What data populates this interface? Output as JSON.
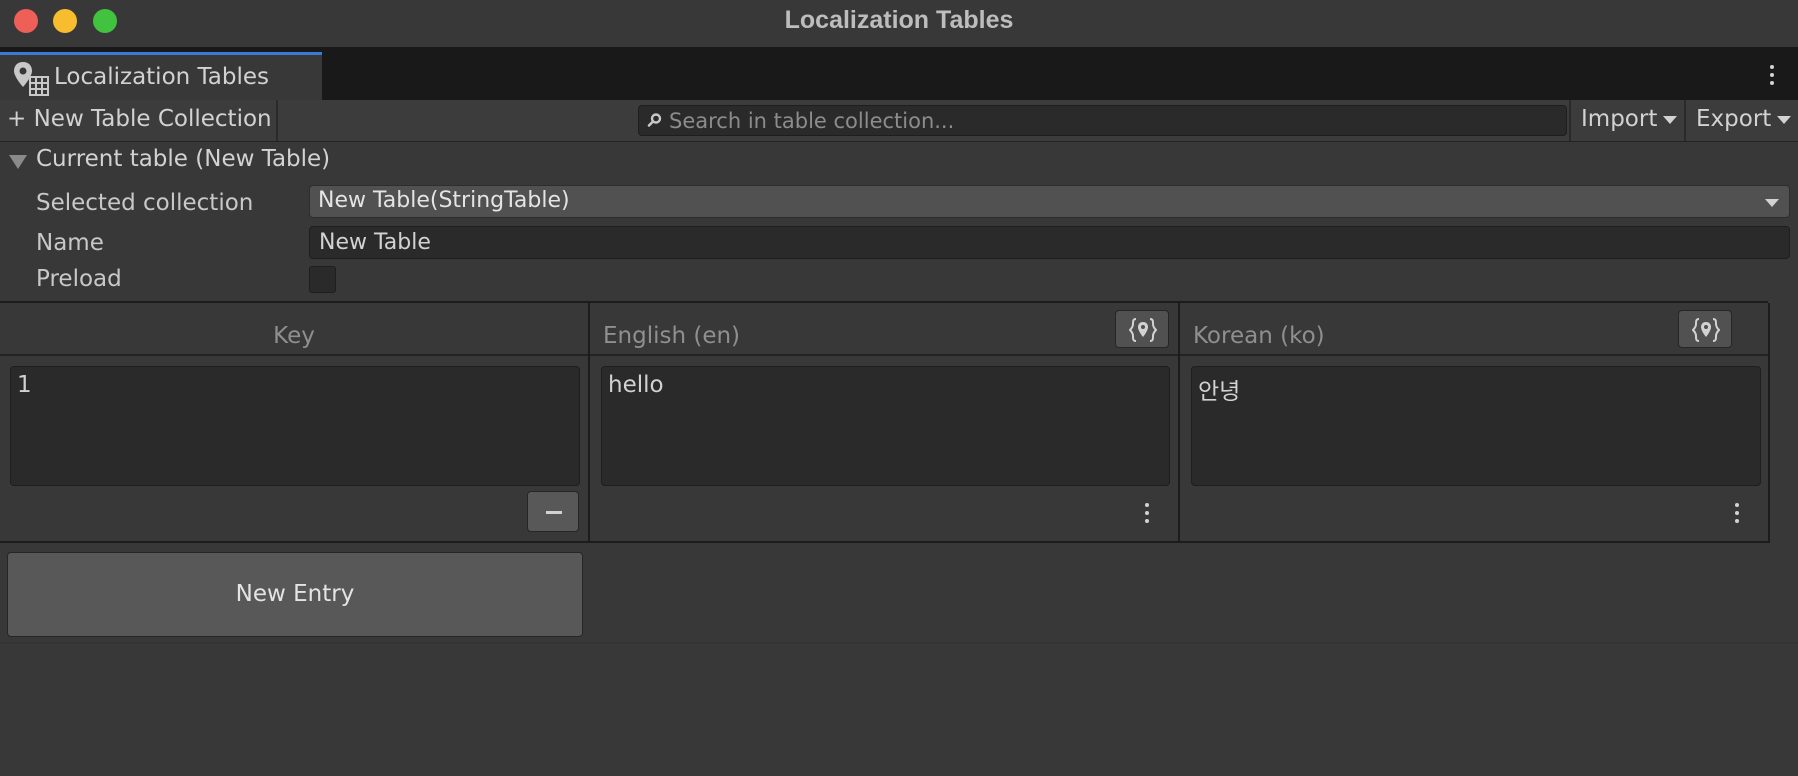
{
  "window": {
    "title": "Localization Tables"
  },
  "tab": {
    "label": "Localization Tables",
    "icon": "localization-table-icon"
  },
  "toolbar": {
    "new_collection_label": "+ New Table Collection",
    "search_placeholder": "Search in table collection...",
    "import_label": "Import",
    "export_label": "Export"
  },
  "section": {
    "title": "Current table (New Table)",
    "selected_collection_label": "Selected collection",
    "selected_collection_value": "New Table(StringTable)",
    "name_label": "Name",
    "name_value": "New Table",
    "preload_label": "Preload",
    "preload_checked": false
  },
  "table": {
    "columns": [
      {
        "header": "Key"
      },
      {
        "header": "English (en)"
      },
      {
        "header": "Korean (ko)"
      }
    ],
    "rows": [
      {
        "key": "1",
        "en": "hello",
        "ko": "안녕"
      }
    ]
  },
  "new_entry_label": "New Entry",
  "colors": {
    "background": "#383838",
    "tab_strip": "#191919",
    "accent": "#3a7bd5",
    "field": "#2a2a2a",
    "button": "#585858"
  }
}
